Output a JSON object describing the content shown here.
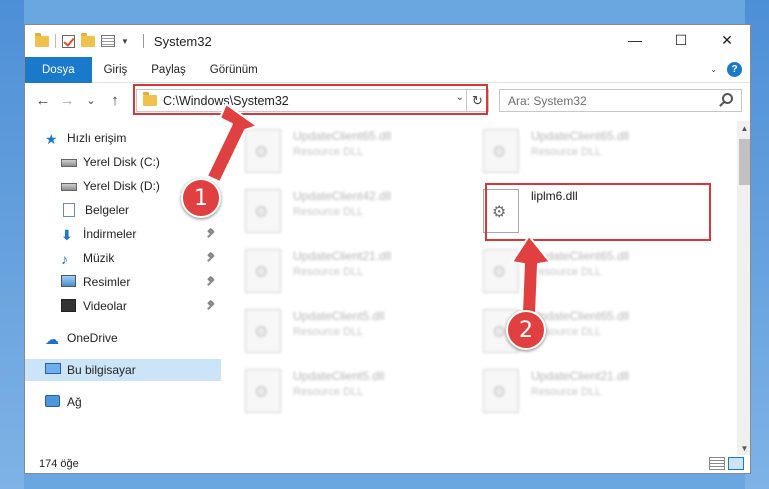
{
  "window": {
    "title": "System32",
    "controls": {
      "minimize": "—",
      "maximize": "☐",
      "close": "✕"
    }
  },
  "ribbon": {
    "tabs": [
      {
        "label": "Dosya",
        "active": true
      },
      {
        "label": "Giriş"
      },
      {
        "label": "Paylaş"
      },
      {
        "label": "Görünüm"
      }
    ],
    "help": "?"
  },
  "nav": {
    "back": "←",
    "forward": "→",
    "recent": "⌄",
    "up": "↑",
    "address": "C:\\Windows\\System32",
    "search_placeholder": "Ara: System32"
  },
  "sidebar": {
    "items": [
      {
        "label": "Hızlı erişim",
        "icon": "star-icon"
      },
      {
        "label": "Yerel Disk (C:)",
        "icon": "drive-icon"
      },
      {
        "label": "Yerel Disk (D:)",
        "icon": "drive-icon"
      },
      {
        "label": "Belgeler",
        "icon": "documents-icon"
      },
      {
        "label": "İndirmeler",
        "icon": "downloads-icon",
        "pinned": true
      },
      {
        "label": "Müzik",
        "icon": "music-icon",
        "pinned": true
      },
      {
        "label": "Resimler",
        "icon": "pictures-icon",
        "pinned": true
      },
      {
        "label": "Videolar",
        "icon": "videos-icon",
        "pinned": true
      },
      {
        "label": "OneDrive",
        "icon": "cloud-icon"
      },
      {
        "label": "Bu bilgisayar",
        "icon": "computer-icon",
        "selected": true
      },
      {
        "label": "Ağ",
        "icon": "network-icon"
      }
    ]
  },
  "files": [
    {
      "name": "UpdateClient65.dll",
      "type": "Resource DLL"
    },
    {
      "name": "UpdateClient65.dll",
      "type": "Resource DLL"
    },
    {
      "name": "UpdateClient42.dll",
      "type": "Resource DLL"
    },
    {
      "name": "liplm6.dll",
      "type": ""
    },
    {
      "name": "UpdateClient21.dll",
      "type": "Resource DLL"
    },
    {
      "name": "UpdateClient65.dll",
      "type": "Resource DLL"
    },
    {
      "name": "UpdateClient5.dll",
      "type": "Resource DLL"
    },
    {
      "name": "UpdateClient65.dll",
      "type": "Resource DLL"
    },
    {
      "name": "UpdateClient5.dll",
      "type": "Resource DLL"
    },
    {
      "name": "UpdateClient21.dll",
      "type": "Resource DLL"
    }
  ],
  "status": {
    "count": "174 öğe"
  },
  "annotations": {
    "step1": "1",
    "step2": "2",
    "color": "#d9363a"
  }
}
